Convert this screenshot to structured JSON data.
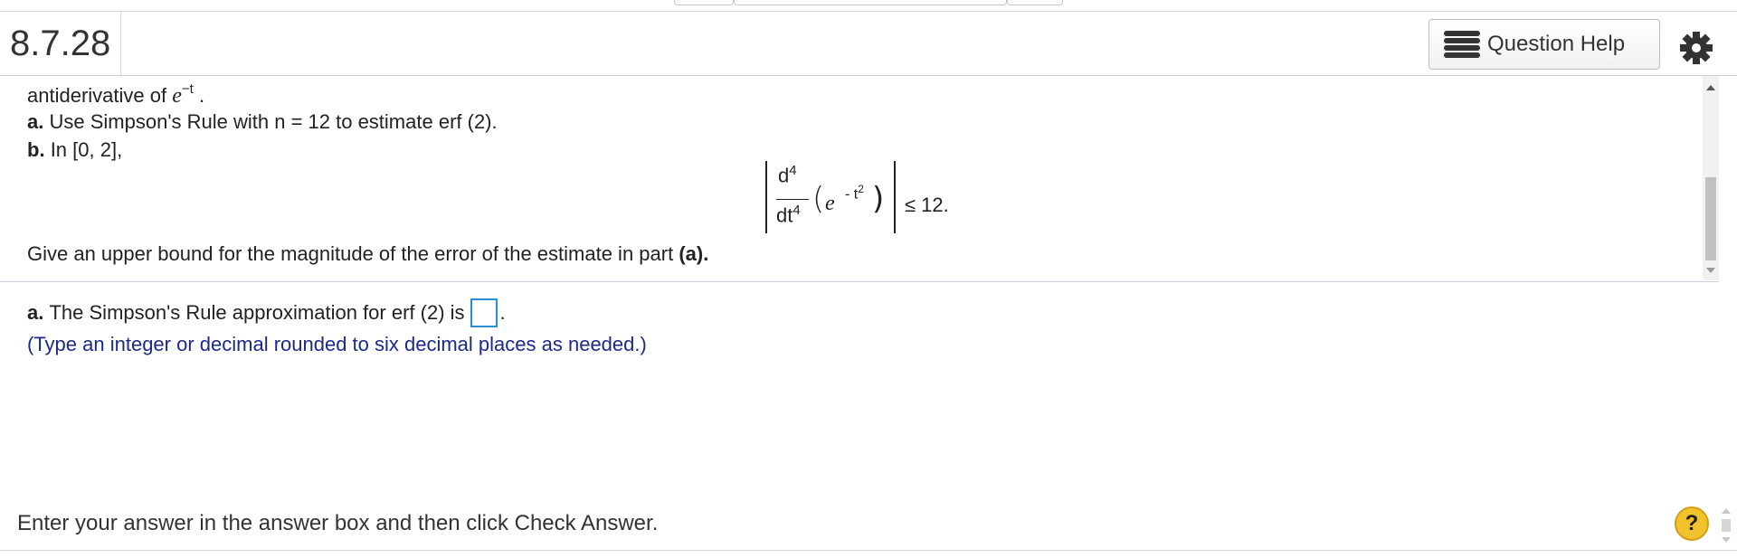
{
  "header": {
    "question_number": "8.7.28",
    "help_label": "Question Help"
  },
  "problem": {
    "intro_text": "antiderivative of",
    "intro_exp": "e",
    "intro_sup": "−t",
    "intro_end": ".",
    "part_a_label": "a.",
    "part_a_text": "Use Simpson's Rule with n = 12 to estimate erf (2).",
    "part_b_label": "b.",
    "part_b_text": "In [0, 2],",
    "formula_num": "d",
    "formula_num_sup": "4",
    "formula_den": "dt",
    "formula_den_sup": "4",
    "formula_e": "e",
    "formula_exp": "- t",
    "formula_exp_sup": "2",
    "formula_rhs": "≤ 12.",
    "bound_text": "Give an upper bound for the magnitude of the error of the estimate in part",
    "bound_part": "(a)."
  },
  "answer": {
    "label": "a.",
    "text": "The Simpson's Rule approximation for erf (2) is",
    "end": ".",
    "hint": "(Type an integer or decimal rounded to six decimal places as needed.)"
  },
  "footer": {
    "instruction": "Enter your answer in the answer box and then click Check Answer.",
    "help_symbol": "?"
  },
  "colors": {
    "answer_box_border": "#2b8fd6",
    "hint_text": "#1b2a8a",
    "help_circle": "#f2c12e"
  }
}
